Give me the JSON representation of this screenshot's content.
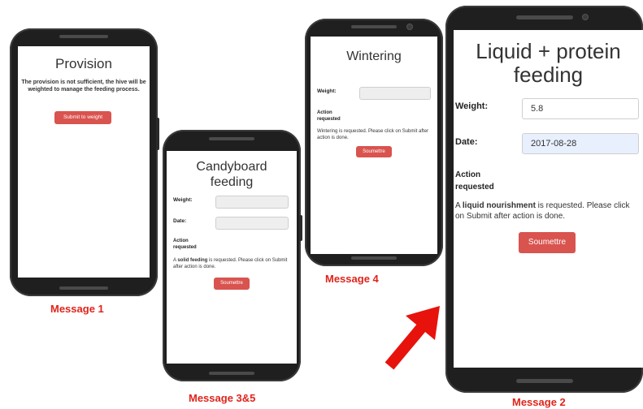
{
  "message1": {
    "caption": "Message 1",
    "title": "Provision",
    "body": "The provision is not sufficient, the hive will be weighted to manage the feeding process.",
    "button": "Submit to weight"
  },
  "message3": {
    "caption": "Message 3&5",
    "title": "Candyboard feeding",
    "weight_label": "Weight:",
    "date_label": "Date:",
    "action_label": "Action requested",
    "action_prefix": "A ",
    "action_bold": "solid feeding",
    "action_suffix": " is requested. Please click on Submit after action is done.",
    "button": "Soumettre"
  },
  "message4": {
    "caption": "Message 4",
    "title": "Wintering",
    "weight_label": "Weight:",
    "action_label": "Action requested",
    "action_text": "Wintering is requested. Please click on Submit after action is done.",
    "button": "Soumettre"
  },
  "message2": {
    "caption": "Message 2",
    "title": "Liquid + protein feeding",
    "weight_label": "Weight:",
    "weight_value": "5.8",
    "date_label": "Date:",
    "date_value": "2017-08-28",
    "action_label": "Action requested",
    "action_prefix": "A ",
    "action_bold": "liquid nourishment",
    "action_suffix": " is requested. Please click on Submit after action is done.",
    "button": "Soumettre"
  },
  "colors": {
    "accent": "#d9534f",
    "caption": "#e0241b",
    "arrow": "#e8120c"
  }
}
